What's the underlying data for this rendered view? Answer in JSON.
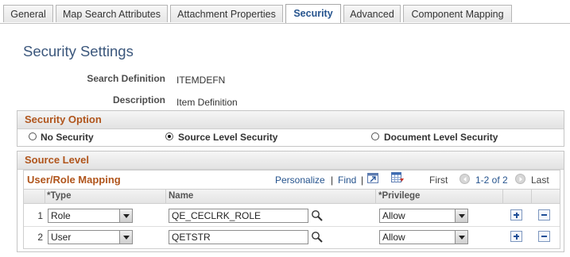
{
  "tabs": [
    {
      "label": "General",
      "active": false
    },
    {
      "label": "Map Search Attributes",
      "active": false
    },
    {
      "label": "Attachment Properties",
      "active": false
    },
    {
      "label": "Security",
      "active": true
    },
    {
      "label": "Advanced",
      "active": false
    },
    {
      "label": "Component Mapping",
      "active": false
    }
  ],
  "page": {
    "title": "Security Settings",
    "search_definition_label": "Search Definition",
    "search_definition_value": "ITEMDEFN",
    "description_label": "Description",
    "description_value": "Item Definition"
  },
  "security_option": {
    "title": "Security Option",
    "options": [
      {
        "label": "No Security",
        "selected": false
      },
      {
        "label": "Source Level Security",
        "selected": true
      },
      {
        "label": "Document Level Security",
        "selected": false
      }
    ]
  },
  "source_level": {
    "title": "Source Level"
  },
  "grid": {
    "title": "User/Role Mapping",
    "personalize": "Personalize",
    "separator": "|",
    "find": "Find",
    "separator2": "|",
    "first": "First",
    "range": "1-2 of 2",
    "last": "Last",
    "columns": {
      "type": "*Type",
      "name": "Name",
      "privilege": "*Privilege"
    },
    "rows": [
      {
        "num": "1",
        "type": "Role",
        "name": "QE_CECLRK_ROLE",
        "privilege": "Allow"
      },
      {
        "num": "2",
        "type": "User",
        "name": "QETSTR",
        "privilege": "Allow"
      }
    ]
  },
  "icons": {
    "lookup": "magnifier-icon",
    "add": "plus-icon",
    "delete": "minus-icon",
    "zoom": "view-all-icon",
    "download": "download-grid-icon",
    "prev": "previous-arrow-icon",
    "next": "next-arrow-icon"
  },
  "colors": {
    "section_title": "#b0551c",
    "link": "#26548e",
    "title": "#3b577c"
  }
}
